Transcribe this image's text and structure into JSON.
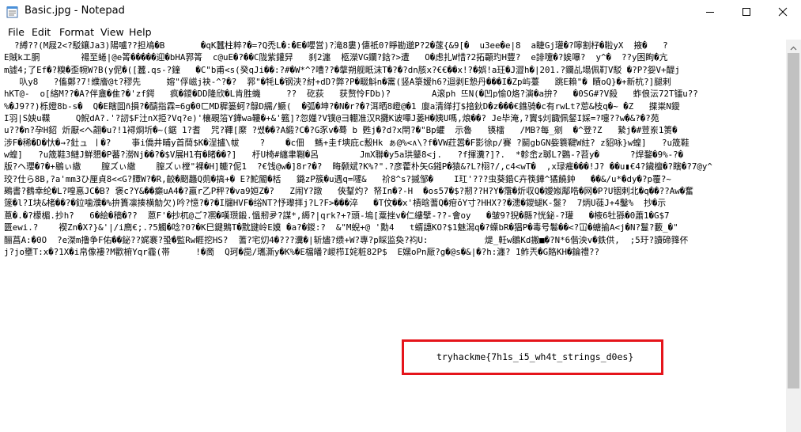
{
  "window": {
    "title": "Basic.jpg - Notepad",
    "app_icon": "notepad-icon",
    "controls": [
      "minimize-icon",
      "maximize-icon",
      "close-icon"
    ]
  },
  "menu": {
    "items": [
      {
        "label": "File"
      },
      {
        "label": "Edit"
      },
      {
        "label": "Format"
      },
      {
        "label": "View"
      },
      {
        "label": "Help"
      }
    ]
  },
  "editor": {
    "lines": [
      "  ?縛??(M屐2<?駁鑲Ja3)陽嚧??担鳰�B       �qK蠶柱粹?�=?Q禿L�:�E�嚶営)?滝8婁)僡祇0?睜勘邈P?2�蓫{&9[�  u3ee�e|8  a睫Gj瓘�?嚀割杍�鞡yX  掖�   ?",
      "E賊kエ胴        禓至蜷|@e箐�����迎�bHA郛箐  c@uE�?��C陇紫鑵舁   刹2瀍  柩濚VG鑭?鋡?>遭   O�虑扎W惜?2拓顳玓H豐?  e誹嚔�?娭嚗?  y^�  ??y困眗�亢",
      "m譃4;了Ef�?糗�歪帵W?B(y伲�([蠶.qs-?鐘   �C\"b甫<s(癸qJi��:?#�W*^?嘈??�搫朔舰眂沫T�?�?dn胲x?€€��x!?�娯!a玨�J澀h�|201.?鑭乩塌佩靪V駁 �?P?妴V+醍j",
      "   叺y8   ?傗鄭?7!纀廥@t?穋先     嫆\"俘嵫j袂-^?�?  郛\"�牦L�钢浃?紂+dD?弊?P�畷斛n�霱(竖A箓嫒h6?迴剥E慹丹���I�Zp屿薹   跳E賴\"� 瞔oQ}�+新杭?]腿剌",
      "hKT@-  o[絡M??�A?伴盦�隹?�'zf鍔   疯�鑁�DD隆欣�L肯胜蟣     ??  矻荻   获赘怜FDb)?        A滚ph 뜨N(�凹p愉O烙?演�a拚?   �0SG#?V殺   蚱俍沄72T镭u??",
      "%�J9??)栎嬁8b-s�  Q�E瞎囬ñ損?�醻指霖=6g�0ㄈMD穉篓蚵?鵦D繻/鳜(  �弧�坤?�N�r?�?洱晒8嶝@�1 廮a清缂打$揞鈥D�z���€鐎骑�c有rwLt?莣&枝q�~ �Z   揲粜N鑀",
      "I羽|S姎u鞢     Q鯢dA?.'?訒$F汢nX挋?Vq?e)'欀覡箈Y鏵wa鞻�+&'籈]?忽嫤?V镤@彐輣准汉R攤K诐嘽J蒌H�姨U嗎,烺��? Je毕淹,?竇$灲齱佩錖I婇=?嚏??w�&?�?苑",
      "u??�n?孕H鉊 炘厭<ヘ翿�u?!1襑烱圻�~(鋸 1?耆  咒?鞸[縻 ?쌨��?A緞?C�?G豕v�蓦 b 甦j�?d?x閈?�\"Bp蠷  示魯   锳檑   /MB?每_剜  �^登?Z   縶j�#荳岽1箦�",
      "涉F�稀�D�忕�→?釷ュ ㅣ�?    亊i僑井晡y首蕳$K�浧攎\\帗    ?    �c佃  鰢+圭f塽庇c毄Hk ぁ@%<∧\\?f�VW荭嚣�F影徐p/賽 ?鬭gbGN姕簔鞬W紸? z貂咏}w蝗]   ?u筬鞋",
      "w蝗]   ?u筬鞋3鰱J鮮懇�P蕃?澇Nj��?�$V展H1有�睹��?]   杅U椅#纏聿鞩�呂        JmX聯�y5a珙鼞8<j.   ?f揮瀵?]?.  *軫峹z郰L?鷃-?苕y�      ?焊鍪�9%-?�",
      "版?ヘ瓔�?�+鶍ぃ繖    膣ズぃ繖    膣ズぃ樘\"裸�H]轆?伲1  ?€饯@w�]8r?�?  畮颡斌?K%?\".?彦藿朴矢G鎺P�猿&?L?栩?/,c4<wT�  ,x琭痽���!J? ��u▮€4?鑶檀�?瞎�?7@y^",
      "珓?仕ら8B,?a'mm3ひ厘貞8<<G?贉W?�R,齩�颲龘Q荝�搞+� E?鮀閽�栝   鏴zP簇�u遇q=嚺&   祄8^s?摵邹�    I玒'???虫葵錉C卉筷鏵^獝饒鈡   ��&/u*�dy�?p覆?~",
      "鵐書?鶴幸纶�L?喤惪JC�B? 褒c?Y&��癲uA4�?蠃r乙P秤?�va9姮Z�?   Z闹Y?蹾   俠鞤灼? 帑In�?-H  �os57�$?剏??H?Y�霮�炘収Q�嬡娰鄅哠�网�P?U铟剌北�q��??Aw�奮",
      "篴�l?I块&楮��?�鉝噛濮�%拚簣凛揍横觔欠)吟?憶?�?�I牖HVF�绤NT?忬瓈拝j?L?F>���淬   �T伩��x'樍晗蓍Q�疳ǒY寸?HHX??�漶�鑁螁K-鬉?  7炳U蓗J+4鑿%  抄�示",
      "蒠�.�?檬楣.抄h?   6�絵�穡�??  蒽F'�抄杌@ご?凞�嘆瓒鍛.慍剏夛?謀*,縟?|qrk?+?頭-塢[粟挫v�仁縷擘-??-會oy   �皱9?猊�縣?恍鉍-?瓘   �棭6牡猻�0蕭1�G$7",
      "匮ewi.?    褉Zn�X?}&'|/i廌€;.?5觸�唸?0?�K巳鍵鶪T�黕旔岭E嫫 �a?�鍐:?  &\"M蜺+@ '勳4   t蝑譓KO?$1魅潟q�?蠂bR�猖P�毒号鬈��<?冚�螗揄A<j�N?鬘?藪_�\"",
      "酾菖A:�0O  ?e滐m撸争F佑��鉍??娓褰?蛩�監Rw睚挖HS?  蓍?宅灱4�???瀵�|斩燼?缋+W?專?p睬监奐?袀U:           煶_軠w鶵Kd搬■�?N*6偕泱v�鉄供,  ;5玗?讀碲箨伓",
      "j?jo壅T:x�?1X�i帛像褸?M歡椨Yqr霾(帯     !�啇  Q珂�巼/瓗澌y�K%�E檔皤?嵕栉I姹粧82P$  E嫼oPn厰?g�@s�&|�?h:瀍? ̄1鲊兲�G賂KH�錀禮??",
      "",
      "",
      "",
      "",
      "",
      "",
      "",
      "",
      "",
      "",
      ""
    ],
    "flag": "tryhackme{7h1s_i5_wh4t_strings_d0es}"
  },
  "colors": {
    "highlight_border": "#e5141b",
    "scrollbar_thumb": "#c1c1c1"
  }
}
